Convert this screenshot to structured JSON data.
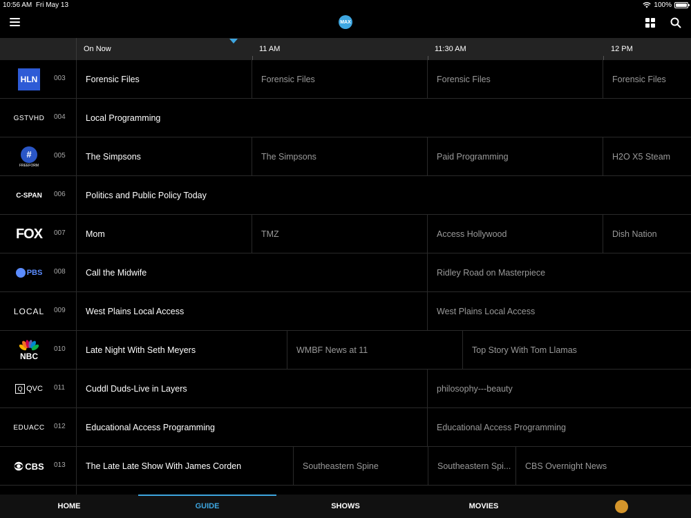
{
  "status": {
    "time": "10:56 AM",
    "date": "Fri May 13",
    "battery": "100%",
    "battery_level": 1.0
  },
  "app": {
    "logo_text": "MAX",
    "accent_color": "#3ea6e0"
  },
  "time_header": {
    "slots": [
      "On Now",
      "11 AM",
      "11:30 AM",
      "12 PM"
    ]
  },
  "channels": [
    {
      "number": "003",
      "logo": "HLN",
      "programs": [
        {
          "title": "Forensic Files",
          "state": "now"
        },
        {
          "title": "Forensic Files",
          "state": "later"
        },
        {
          "title": "Forensic Files",
          "state": "later"
        },
        {
          "title": "Forensic Files",
          "state": "later"
        }
      ]
    },
    {
      "number": "004",
      "logo": "GSTVHD",
      "programs": [
        {
          "title": "Local Programming",
          "state": "now"
        }
      ]
    },
    {
      "number": "005",
      "logo": "FREEFORM",
      "programs": [
        {
          "title": "The Simpsons",
          "state": "now"
        },
        {
          "title": "The Simpsons",
          "state": "later"
        },
        {
          "title": "Paid Programming",
          "state": "later"
        },
        {
          "title": "H2O X5 Steam",
          "state": "later"
        }
      ]
    },
    {
      "number": "006",
      "logo": "C-SPAN",
      "programs": [
        {
          "title": "Politics and Public Policy Today",
          "state": "now"
        }
      ]
    },
    {
      "number": "007",
      "logo": "FOX",
      "programs": [
        {
          "title": "Mom",
          "state": "now"
        },
        {
          "title": "TMZ",
          "state": "later"
        },
        {
          "title": "Access Hollywood",
          "state": "later"
        },
        {
          "title": "Dish Nation",
          "state": "later"
        }
      ]
    },
    {
      "number": "008",
      "logo": "PBS",
      "programs": [
        {
          "title": "Call the Midwife",
          "state": "now"
        },
        {
          "title": "Ridley Road on Masterpiece",
          "state": "later"
        }
      ]
    },
    {
      "number": "009",
      "logo": "LOCAL",
      "programs": [
        {
          "title": "West Plains Local Access",
          "state": "now"
        },
        {
          "title": "West Plains Local Access",
          "state": "later"
        }
      ]
    },
    {
      "number": "010",
      "logo": "NBC",
      "programs": [
        {
          "title": "Late Night With Seth Meyers",
          "state": "now"
        },
        {
          "title": "WMBF News at 11",
          "state": "later"
        },
        {
          "title": "Top Story With Tom Llamas",
          "state": "later"
        }
      ]
    },
    {
      "number": "011",
      "logo": "QVC",
      "programs": [
        {
          "title": "Cuddl Duds-Live in Layers",
          "state": "now"
        },
        {
          "title": "philosophy---beauty",
          "state": "later"
        }
      ]
    },
    {
      "number": "012",
      "logo": "EDUACC",
      "programs": [
        {
          "title": "Educational Access Programming",
          "state": "now"
        },
        {
          "title": "Educational Access Programming",
          "state": "later"
        }
      ]
    },
    {
      "number": "013",
      "logo": "CBS",
      "programs": [
        {
          "title": "The Late Late Show With James Corden",
          "state": "now"
        },
        {
          "title": "Southeastern Spine",
          "state": "later"
        },
        {
          "title": "Southeastern Spi...",
          "state": "later"
        },
        {
          "title": "CBS Overnight News",
          "state": "later"
        }
      ]
    }
  ],
  "bottom_nav": {
    "tabs": [
      "HOME",
      "GUIDE",
      "SHOWS",
      "MOVIES"
    ],
    "active": "GUIDE"
  }
}
